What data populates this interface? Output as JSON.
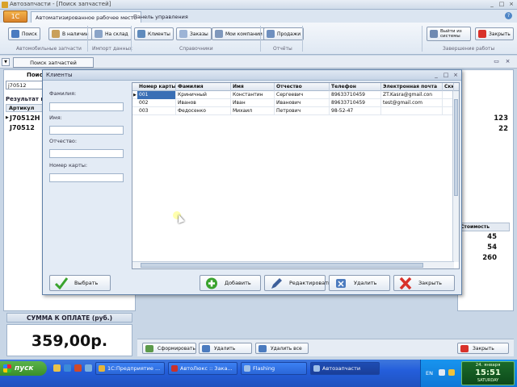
{
  "window": {
    "title": "Автозапчасти - [Поиск запчастей]",
    "min": "_",
    "max": "□",
    "close": "×"
  },
  "ribbon": {
    "orb_label": "1С",
    "tabs": [
      "Автоматизированное рабочее место",
      "Панель управления"
    ],
    "buttons": {
      "search": "Поиск",
      "in_stock": "В наличии",
      "to_stock": "На склад",
      "clients": "Клиенты",
      "orders": "Заказы",
      "my_companies": "Мои компании",
      "sales": "Продажи",
      "logout": "Выйти из системы",
      "close": "Закрыть"
    },
    "groups": {
      "auto_parts": "Автомобильные запчасти",
      "import": "Импорт данных",
      "references": "Справочники",
      "reports": "Отчёты",
      "finish": "Завершение работы"
    },
    "help": "?"
  },
  "background": {
    "tab_label": "Поиск запчастей",
    "search_label": "Поиск",
    "search_value": "j70512",
    "results_label": "Результат по",
    "article_header": "Артикул",
    "articles": [
      "J70512H",
      "J70512"
    ],
    "right_values_top": [
      "123",
      "22"
    ],
    "right_header": "Стоимость",
    "right_values_bottom": [
      "45",
      "54",
      "260"
    ],
    "pay_label": "СУММА К ОПЛАТЕ (руб.)",
    "pay_amount": "359,00р.",
    "bottom_buttons": {
      "form": "Сформировать",
      "delete": "Удалить",
      "delete_all": "Удалить все",
      "close": "Закрыть"
    }
  },
  "dialog": {
    "title": "Клиенты",
    "fields": {
      "last_name": "Фамилия:",
      "first_name": "Имя:",
      "patronymic": "Отчество:",
      "card_number": "Номер карты:"
    },
    "columns": [
      "Номер карты",
      "Фамилия",
      "Имя",
      "Отчество",
      "Телефон",
      "Электронная почта",
      "Ски"
    ],
    "rows": [
      [
        "001",
        "Криничный",
        "Константин",
        "Сергеевич",
        "89633710459",
        "ZT.Kasra@gmail.con",
        ""
      ],
      [
        "002",
        "Иванов",
        "Иван",
        "Иванович",
        "89633710459",
        "test@gmail.com",
        ""
      ],
      [
        "003",
        "Федосенко",
        "Михаил",
        "Петрович",
        "98-52-47",
        "",
        ""
      ]
    ],
    "buttons": {
      "select": "Выбрать",
      "add": "Добавить",
      "edit": "Редактировать",
      "delete": "Удалить",
      "close": "Закрыть"
    }
  },
  "taskbar": {
    "start": "пуск",
    "windows": [
      "1С:Предприятие ...",
      "АвтоЛюкс :: Зака...",
      "Flashing",
      "Автозапчасти"
    ],
    "lang": "EN",
    "clock_date": "24. января",
    "clock_time": "15:51",
    "clock_weekday": "SATURDAY"
  },
  "colors": {
    "selection": "#3a6fb5",
    "taskbar": "#245edb",
    "start": "#3a8f2a"
  }
}
